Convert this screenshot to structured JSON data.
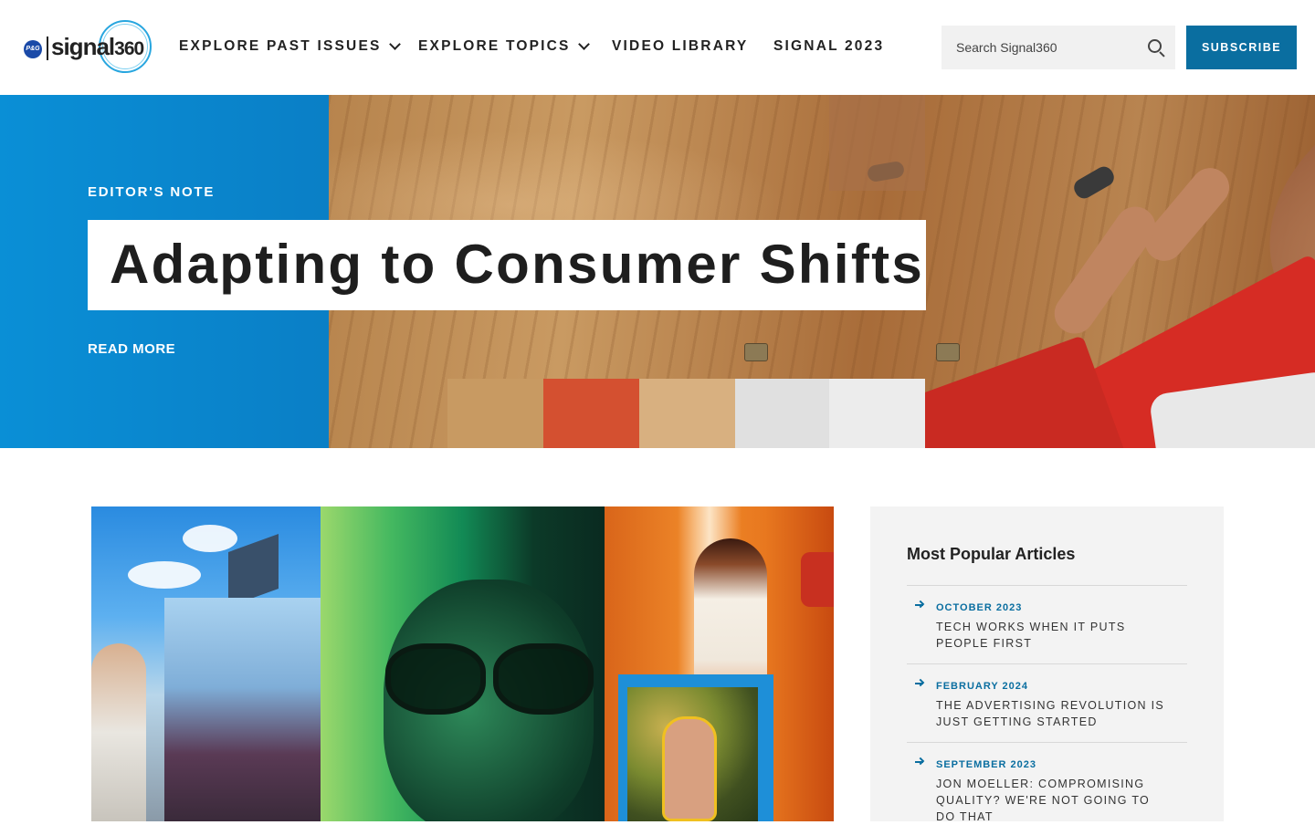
{
  "header": {
    "logo_text": "signal",
    "logo_number": "360",
    "logo_brand": "P&G",
    "nav": [
      {
        "label": "EXPLORE PAST ISSUES",
        "has_dropdown": true
      },
      {
        "label": "EXPLORE TOPICS",
        "has_dropdown": true
      },
      {
        "label": "VIDEO LIBRARY",
        "has_dropdown": false
      },
      {
        "label": "SIGNAL 2023",
        "has_dropdown": false
      }
    ],
    "search_placeholder": "Search Signal360",
    "subscribe_label": "SUBSCRIBE"
  },
  "hero": {
    "eyebrow": "EDITOR'S NOTE",
    "title": "Adapting to Consumer Shifts",
    "read_more": "READ MORE"
  },
  "popular": {
    "heading": "Most Popular Articles",
    "items": [
      {
        "date": "OCTOBER 2023",
        "title": "TECH WORKS WHEN IT PUTS PEOPLE FIRST"
      },
      {
        "date": "FEBRUARY 2024",
        "title": "THE ADVERTISING REVOLUTION IS JUST GETTING STARTED"
      },
      {
        "date": "SEPTEMBER 2023",
        "title": "JON MOELLER: COMPROMISING QUALITY? WE'RE NOT GOING TO DO THAT"
      }
    ]
  },
  "colors": {
    "brand_blue": "#0a6ea0",
    "hero_blue": "#0a8fd6",
    "panel_bg": "#f3f3f3"
  }
}
